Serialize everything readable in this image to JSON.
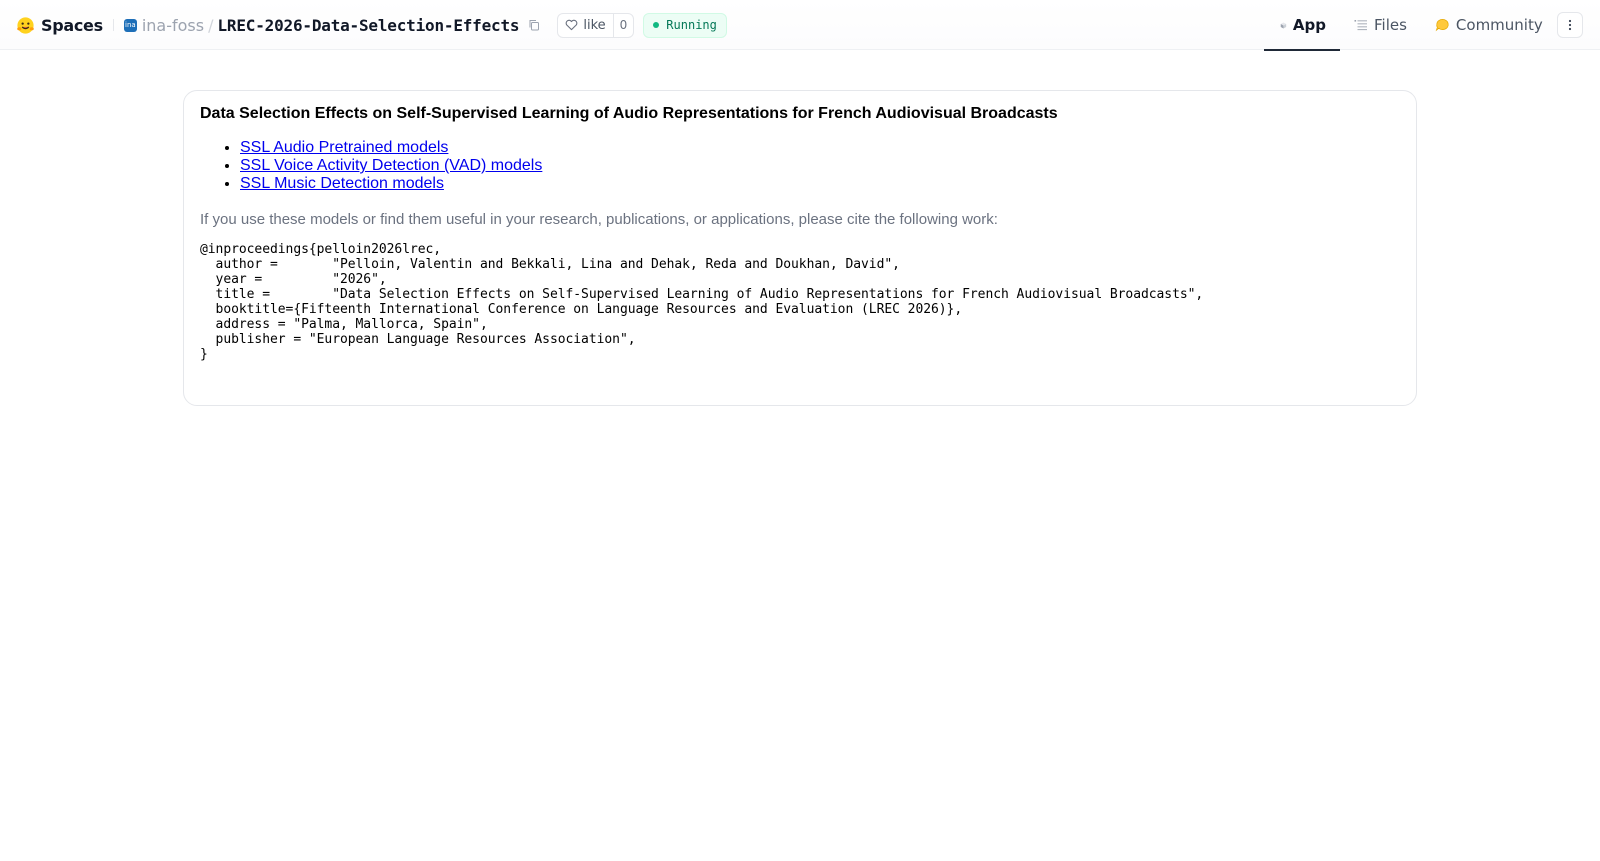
{
  "header": {
    "brand": "Spaces",
    "org_avatar_text": "ina",
    "org": "ina-foss",
    "separator": "/",
    "repo": "LREC-2026-Data-Selection-Effects",
    "like_label": "like",
    "like_count": "0",
    "status": "Running",
    "tabs": [
      {
        "label": "App",
        "icon": "app-cube-icon",
        "active": true
      },
      {
        "label": "Files",
        "icon": "files-icon",
        "active": false
      },
      {
        "label": "Community",
        "icon": "community-icon",
        "active": false
      }
    ]
  },
  "content": {
    "title": "Data Selection Effects on Self-Supervised Learning of Audio Representations for French Audiovisual Broadcasts",
    "links": [
      "SSL Audio Pretrained models",
      "SSL Voice Activity Detection (VAD) models",
      "SSL Music Detection models"
    ],
    "cite_note": "If you use these models or find them useful in your research, publications, or applications, please cite the following work:",
    "bibtex": "@inproceedings{pelloin2026lrec,\n  author =       \"Pelloin, Valentin and Bekkali, Lina and Dehak, Reda and Doukhan, David\",\n  year =         \"2026\",\n  title =        \"Data Selection Effects on Self-Supervised Learning of Audio Representations for French Audiovisual Broadcasts\",\n  booktitle={Fifteenth International Conference on Language Resources and Evaluation (LREC 2026)},\n  address = \"Palma, Mallorca, Spain\",\n  publisher = \"European Language Resources Association\",\n}"
  },
  "colors": {
    "link": "#0000ee",
    "status_text": "#047857",
    "status_bg": "#ecfdf5",
    "status_dot": "#10b981",
    "muted_text": "#6b7280",
    "active_tab_underline": "#1f2937",
    "org_avatar": "#1e6fb8"
  }
}
